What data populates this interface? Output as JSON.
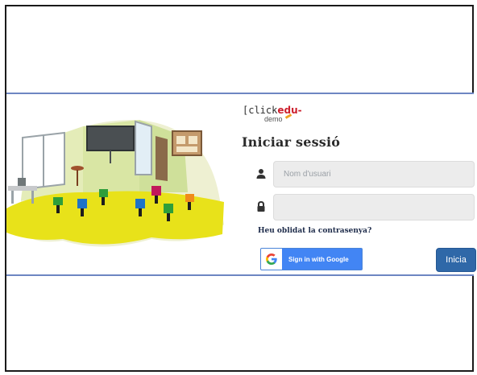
{
  "logo": {
    "prefix": "[click",
    "brand": "edu",
    "suffix": "-",
    "subtitle": "demo"
  },
  "login": {
    "title": "Iniciar sessió",
    "username_placeholder": "Nom d'usuari",
    "username_value": "",
    "password_value": "",
    "forgot_link": "Heu oblidat la contrasenya?",
    "google_label": "Sign in with Google",
    "submit_label": "Inicia"
  },
  "icons": {
    "username": "user-icon",
    "password": "lock-icon",
    "google": "google-icon"
  },
  "colors": {
    "panel_border": "#6d86c2",
    "brand_red": "#cc1f2d",
    "google_blue": "#4285f4",
    "submit_blue": "#2f68a8",
    "field_bg": "#ececec"
  }
}
